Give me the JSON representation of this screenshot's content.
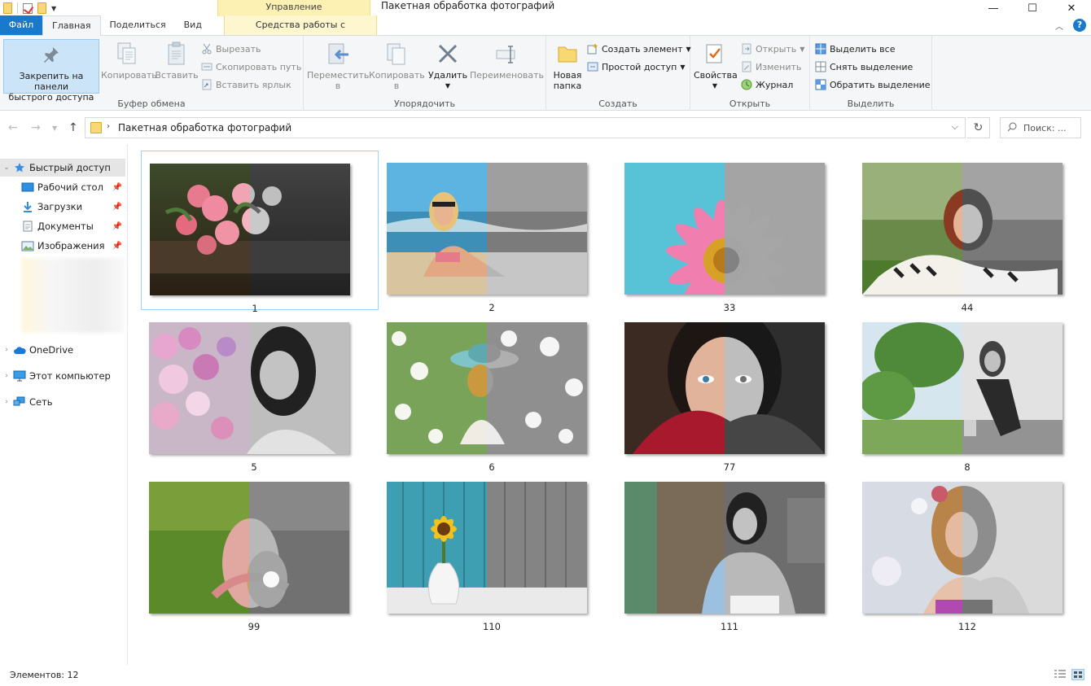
{
  "window": {
    "title": "Пакетная обработка фотографий",
    "contextual_group": "Управление"
  },
  "tabs": {
    "file": "Файл",
    "home": "Главная",
    "share": "Поделиться",
    "view": "Вид",
    "picture_tools": "Средства работы с рисунками"
  },
  "ribbon": {
    "clipboard": {
      "label": "Буфер обмена",
      "pin_line1": "Закрепить на панели",
      "pin_line2": "быстрого доступа",
      "copy": "Копировать",
      "paste": "Вставить",
      "cut": "Вырезать",
      "copy_path": "Скопировать путь",
      "paste_shortcut": "Вставить ярлык"
    },
    "organize": {
      "label": "Упорядочить",
      "move_to_1": "Переместить",
      "move_to_2": "в",
      "copy_to_1": "Копировать",
      "copy_to_2": "в",
      "delete": "Удалить",
      "rename": "Переименовать"
    },
    "new": {
      "label": "Создать",
      "new_folder_1": "Новая",
      "new_folder_2": "папка",
      "new_item": "Создать элемент",
      "easy_access": "Простой доступ"
    },
    "open": {
      "label": "Открыть",
      "properties": "Свойства",
      "open": "Открыть",
      "edit": "Изменить",
      "history": "Журнал"
    },
    "select": {
      "label": "Выделить",
      "select_all": "Выделить все",
      "select_none": "Снять выделение",
      "invert": "Обратить выделение"
    }
  },
  "address": {
    "path": "Пакетная обработка фотографий",
    "search_placeholder": "Поиск: ..."
  },
  "nav": {
    "quick_access": "Быстрый доступ",
    "desktop": "Рабочий стол",
    "downloads": "Загрузки",
    "documents": "Документы",
    "pictures": "Изображения",
    "onedrive": "OneDrive",
    "this_pc": "Этот компьютер",
    "network": "Сеть"
  },
  "files": [
    {
      "label": "1",
      "icon": "roses-photo"
    },
    {
      "label": "2",
      "icon": "beach-woman-photo"
    },
    {
      "label": "33",
      "icon": "pink-daisy-photo"
    },
    {
      "label": "44",
      "icon": "woman-on-grass-photo"
    },
    {
      "label": "5",
      "icon": "woman-with-flowers-photo"
    },
    {
      "label": "6",
      "icon": "woman-in-blossoms-photo"
    },
    {
      "label": "77",
      "icon": "woman-face-closeup-photo"
    },
    {
      "label": "8",
      "icon": "woman-in-park-photo"
    },
    {
      "label": "99",
      "icon": "woman-lying-grass-photo"
    },
    {
      "label": "110",
      "icon": "sunflower-vase-photo"
    },
    {
      "label": "111",
      "icon": "woman-cafe-photo"
    },
    {
      "label": "112",
      "icon": "woman-portrait-photo"
    }
  ],
  "status": {
    "items_count": "Элементов: 12"
  },
  "colors": {
    "accent": "#1979ca",
    "selection": "#cce4f7",
    "contextual": "#fdf0b3"
  }
}
